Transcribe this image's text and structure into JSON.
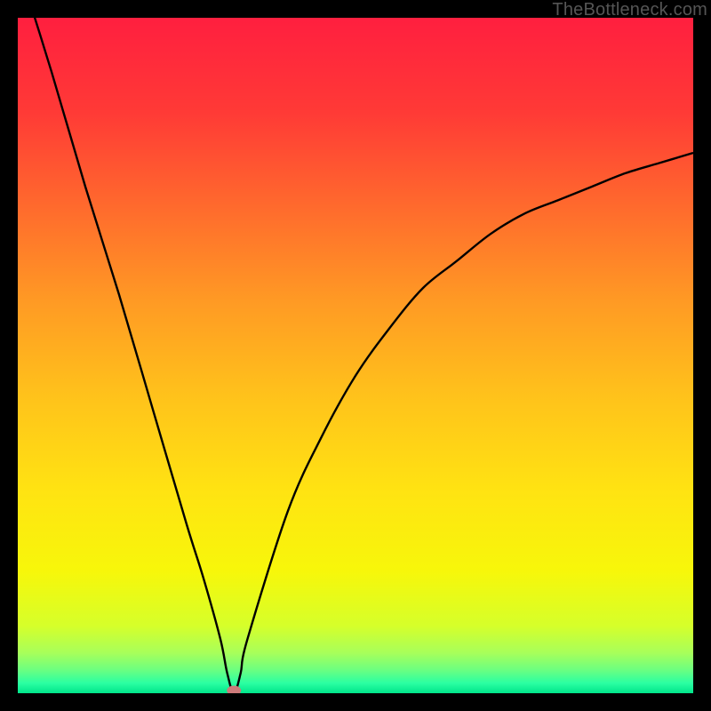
{
  "watermark": "TheBottleneck.com",
  "chart_data": {
    "type": "line",
    "title": "",
    "xlabel": "",
    "ylabel": "",
    "xlim": [
      0,
      100
    ],
    "ylim": [
      0,
      100
    ],
    "x": [
      0,
      5,
      10,
      15,
      20,
      25,
      27.5,
      30,
      31,
      32,
      33,
      34,
      40,
      45,
      50,
      55,
      60,
      65,
      70,
      75,
      80,
      85,
      90,
      95,
      100
    ],
    "y": [
      108,
      92,
      75,
      59,
      42,
      25,
      17,
      8,
      3,
      0,
      3,
      8,
      27,
      38,
      47,
      54,
      60,
      64,
      68,
      71,
      73,
      75,
      77,
      78.5,
      80
    ],
    "marker": {
      "x": 32,
      "y": 0
    },
    "background_gradient": [
      {
        "stop": 0.0,
        "color": "#ff1f3f"
      },
      {
        "stop": 0.14,
        "color": "#ff3a36"
      },
      {
        "stop": 0.28,
        "color": "#ff6a2d"
      },
      {
        "stop": 0.42,
        "color": "#ff9a24"
      },
      {
        "stop": 0.56,
        "color": "#ffc21b"
      },
      {
        "stop": 0.7,
        "color": "#ffe312"
      },
      {
        "stop": 0.82,
        "color": "#f7f70a"
      },
      {
        "stop": 0.9,
        "color": "#d6ff2a"
      },
      {
        "stop": 0.94,
        "color": "#a8ff5a"
      },
      {
        "stop": 0.965,
        "color": "#6dff80"
      },
      {
        "stop": 0.985,
        "color": "#2bffa2"
      },
      {
        "stop": 1.0,
        "color": "#00e58a"
      }
    ]
  }
}
